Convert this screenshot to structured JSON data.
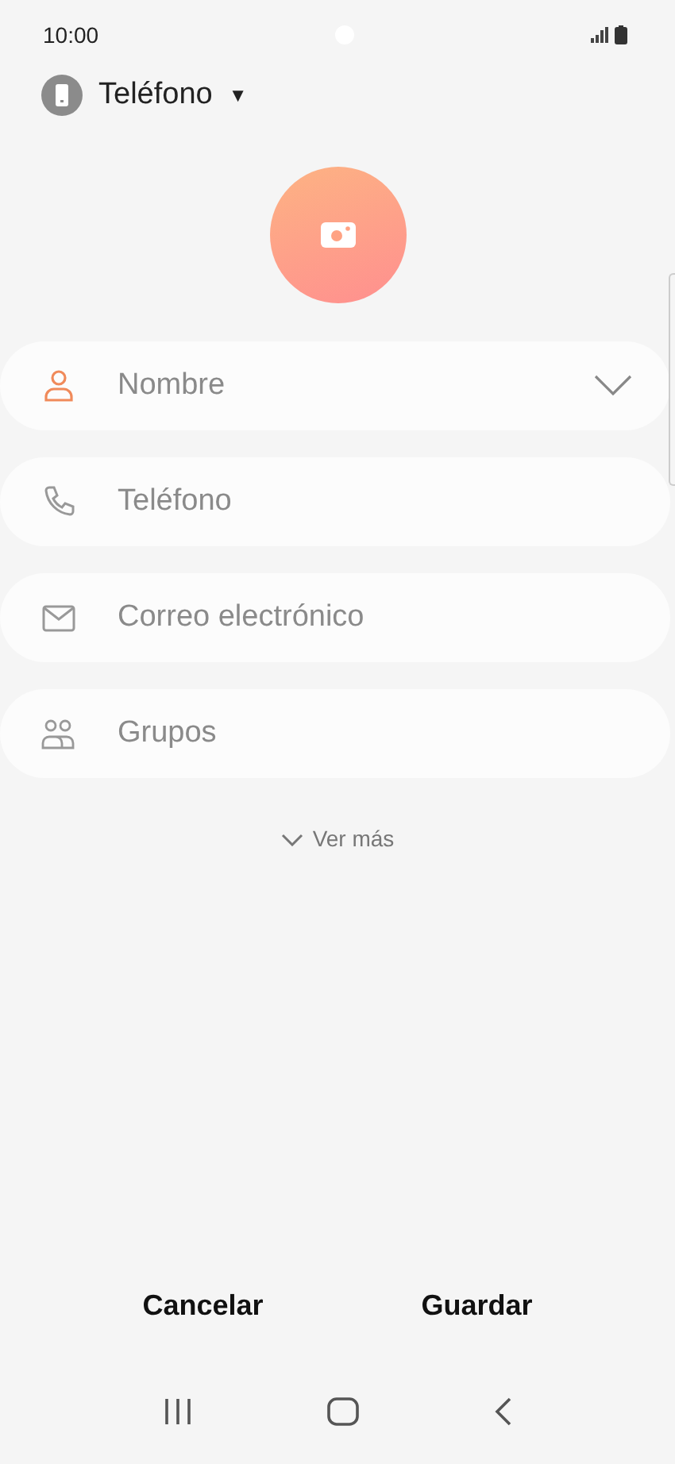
{
  "status_bar": {
    "time": "10:00"
  },
  "account": {
    "label": "Teléfono",
    "caret": "▼"
  },
  "fields": [
    {
      "kind": "name",
      "placeholder": "Nombre",
      "focused": true,
      "expandable": true
    },
    {
      "kind": "phone",
      "placeholder": "Teléfono",
      "focused": false,
      "expandable": false
    },
    {
      "kind": "email",
      "placeholder": "Correo electrónico",
      "focused": false,
      "expandable": false
    },
    {
      "kind": "groups",
      "placeholder": "Grupos",
      "focused": false,
      "expandable": false
    }
  ],
  "more": {
    "label": "Ver más"
  },
  "actions": [
    {
      "label": "Cancelar"
    },
    {
      "label": "Guardar"
    }
  ]
}
